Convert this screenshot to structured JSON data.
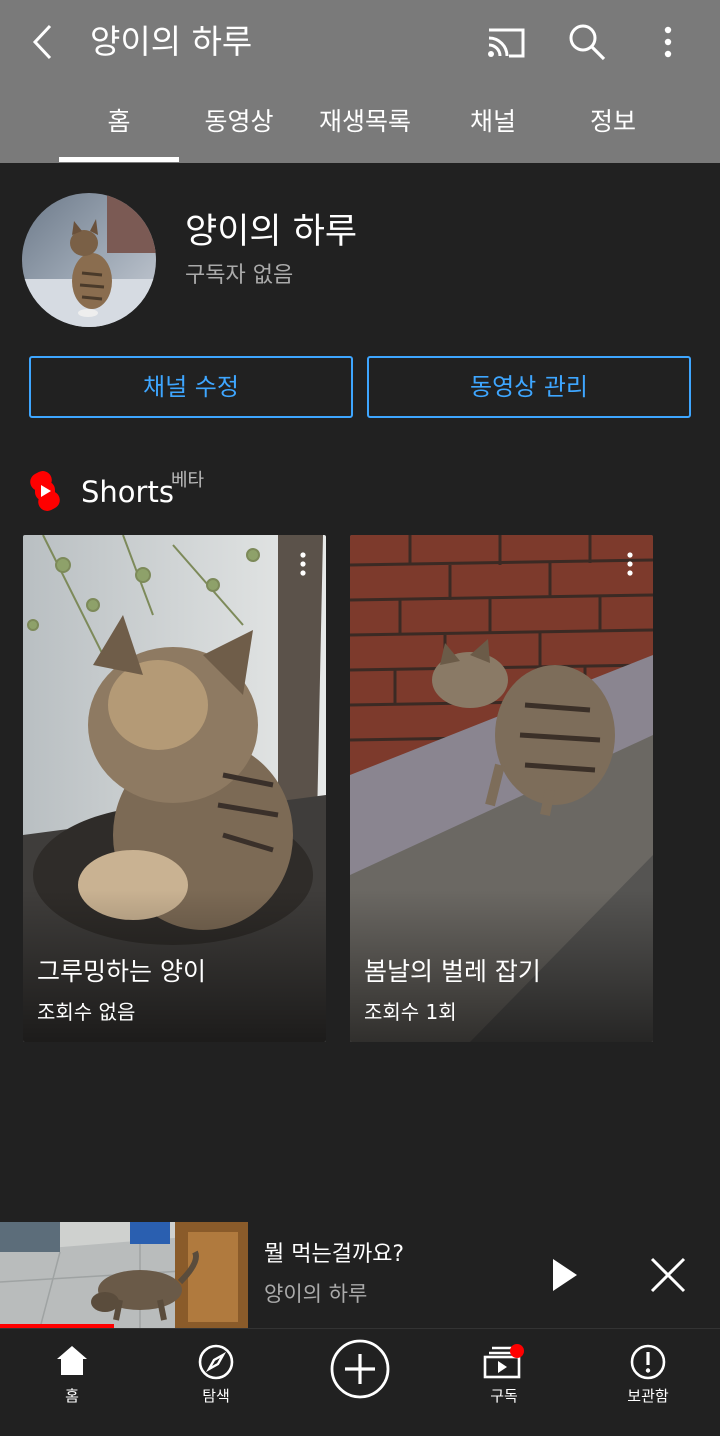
{
  "header": {
    "title": "양이의 하루",
    "tabs": [
      "홈",
      "동영상",
      "재생목록",
      "채널",
      "정보"
    ]
  },
  "channel": {
    "name": "양이의 하루",
    "subscribers": "구독자 없음",
    "edit_button": "채널 수정",
    "manage_button": "동영상 관리"
  },
  "shorts": {
    "label": "Shorts",
    "badge": "베타",
    "items": [
      {
        "title": "그루밍하는 양이",
        "views": "조회수 없음"
      },
      {
        "title": "봄날의 벌레 잡기",
        "views": "조회수 1회"
      }
    ]
  },
  "miniplayer": {
    "title": "뭘 먹는걸까요?",
    "channel": "양이의 하루",
    "progress": 0.46
  },
  "bottom_nav": {
    "home": "홈",
    "explore": "탐색",
    "subscriptions": "구독",
    "library": "보관함"
  },
  "colors": {
    "accent": "#3ea6ff",
    "brand_red": "#ff0000",
    "background": "#212121",
    "appbar": "#7a7a7a"
  },
  "icons": [
    "back-arrow-icon",
    "cast-icon",
    "search-icon",
    "more-vert-icon",
    "shorts-icon",
    "play-icon",
    "close-icon",
    "home-icon",
    "explore-icon",
    "create-icon",
    "subscriptions-icon",
    "library-icon"
  ]
}
